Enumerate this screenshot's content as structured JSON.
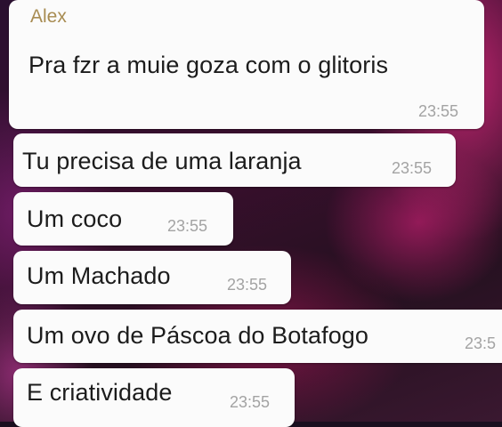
{
  "chat": {
    "sender": "Alex",
    "messages": [
      {
        "text": "Pra fzr a muie goza com o glitoris",
        "time": "23:55"
      },
      {
        "text": "Tu precisa de uma laranja",
        "time": "23:55"
      },
      {
        "text": "Um coco",
        "time": "23:55"
      },
      {
        "text": "Um Machado",
        "time": "23:55"
      },
      {
        "text": "Um ovo de Páscoa do Botafogo",
        "time": "23:5"
      },
      {
        "text": "E criatividade",
        "time": "23:55"
      }
    ]
  },
  "colors": {
    "bubble": "#fbfbfb",
    "sender": "#a88c52",
    "timestamp": "#a3a3a3",
    "text": "#1c1c1c"
  }
}
